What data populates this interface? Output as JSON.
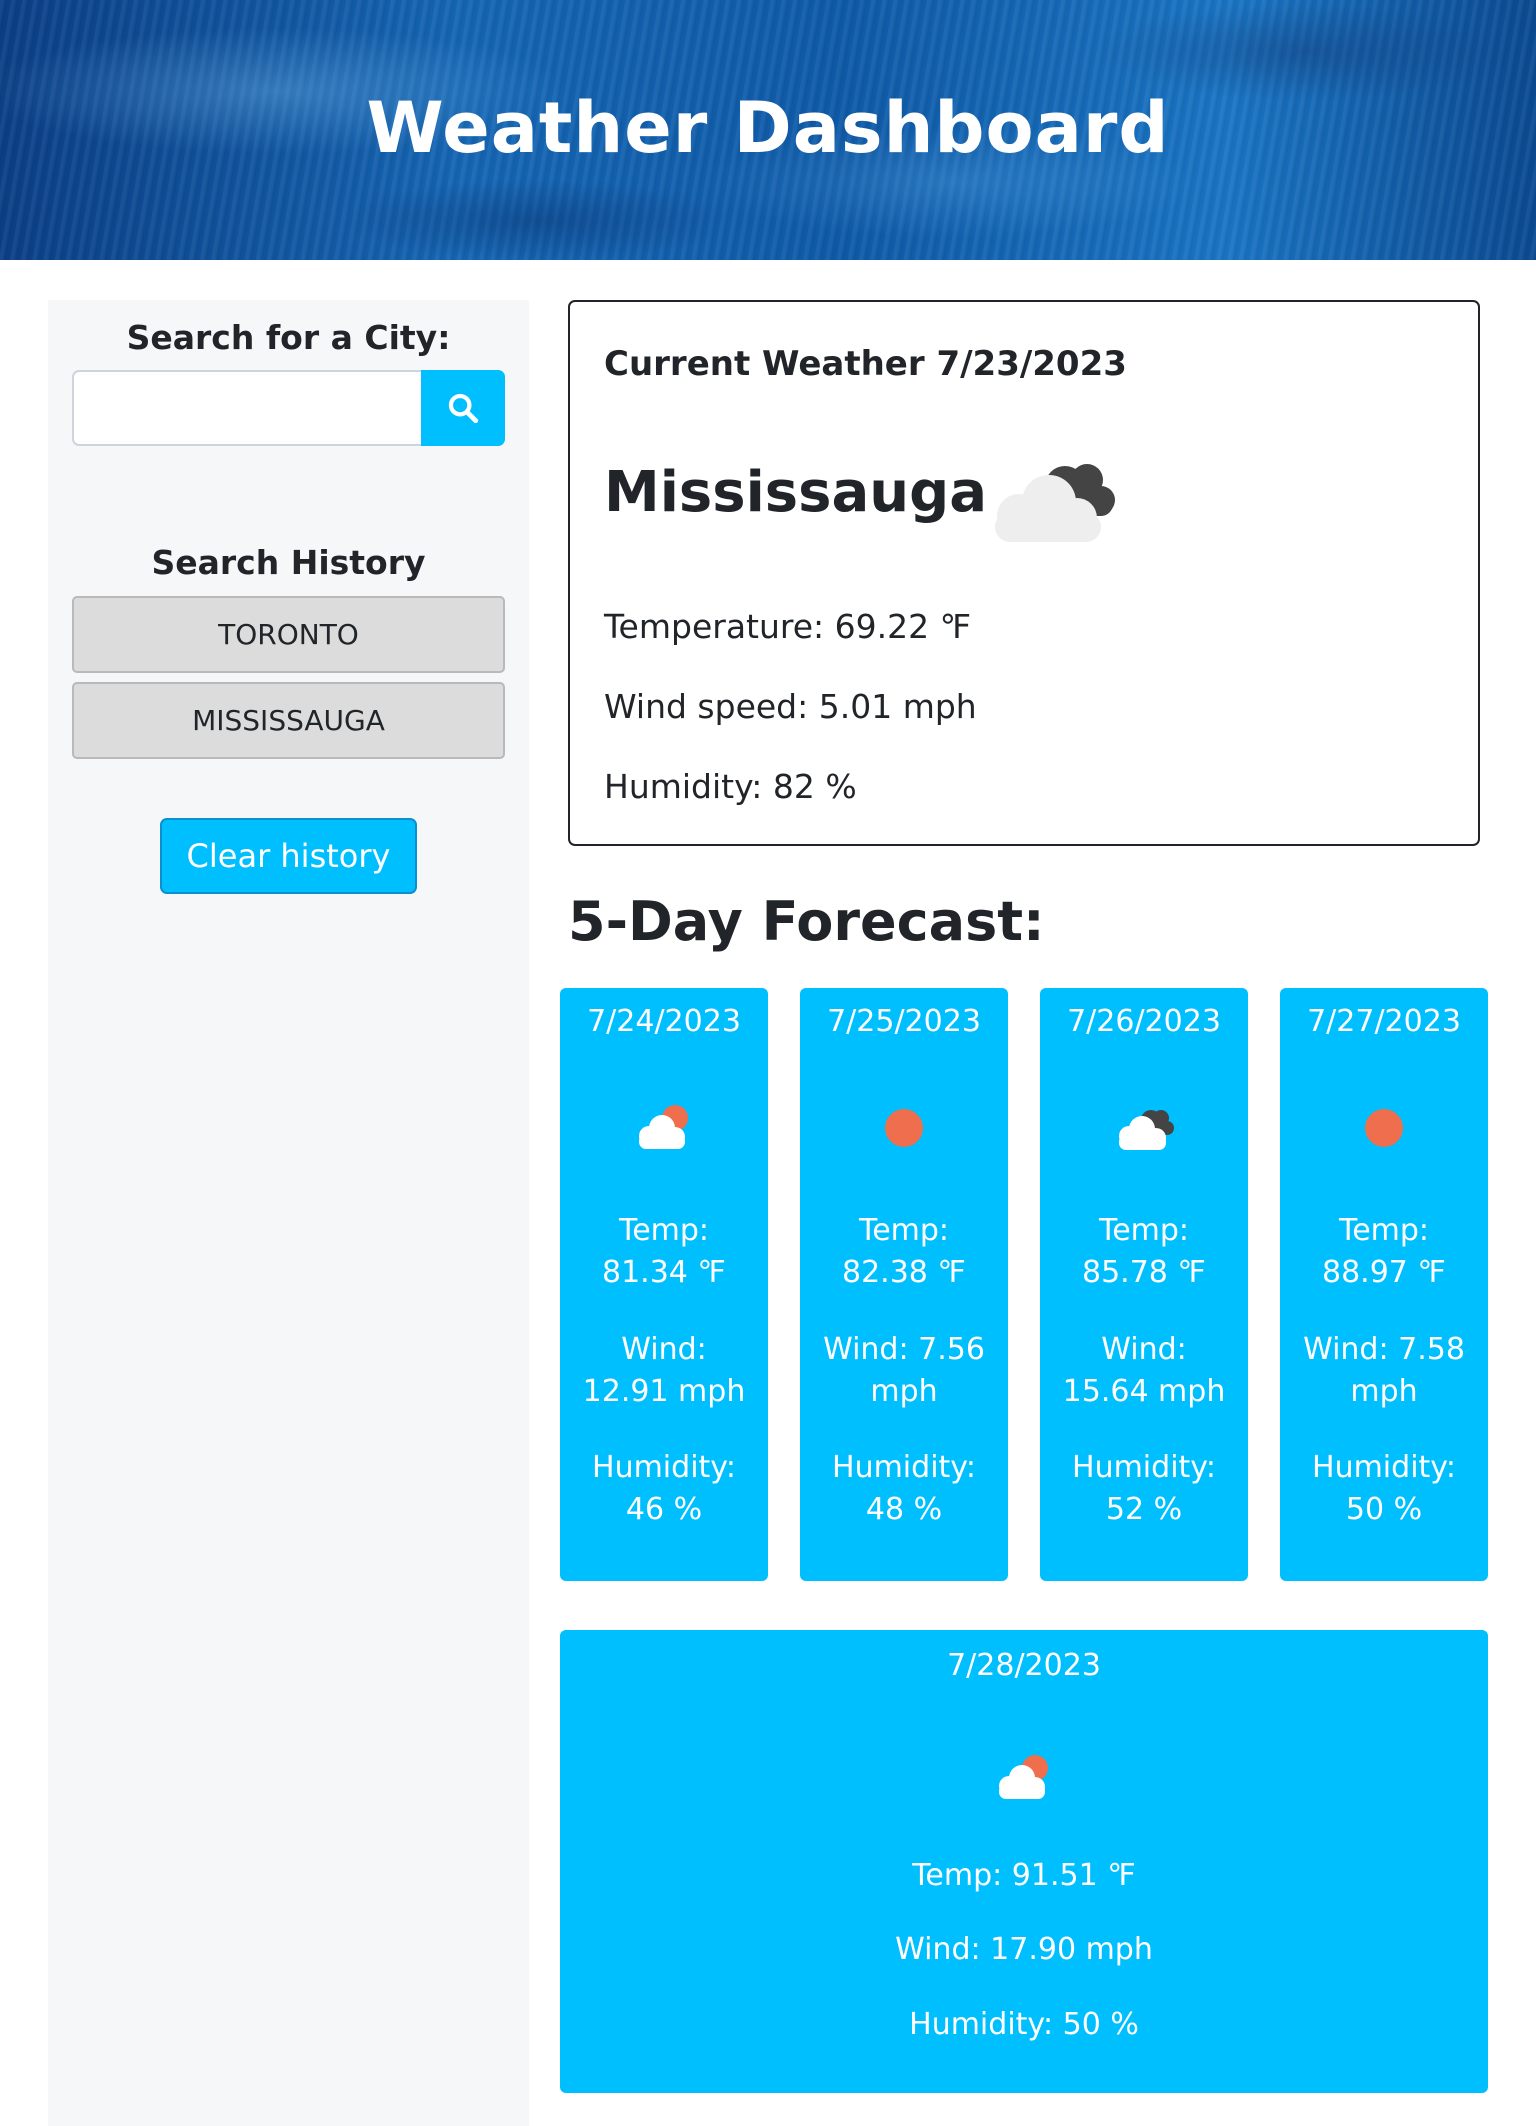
{
  "header": {
    "title": "Weather Dashboard"
  },
  "sidebar": {
    "search_label": "Search for a City:",
    "search_input_value": "",
    "search_input_placeholder": "",
    "search_button_icon": "search-icon",
    "history_label": "Search History",
    "history": [
      "TORONTO",
      "MISSISSAUGA"
    ],
    "clear_label": "Clear history"
  },
  "current": {
    "title": "Current Weather 7/23/2023",
    "city": "Mississauga",
    "icon": "broken-clouds-icon",
    "temperature": "Temperature: 69.22 ℉",
    "wind": "Wind speed: 5.01 mph",
    "humidity": "Humidity: 82 %"
  },
  "forecast": {
    "title": "5-Day Forecast:",
    "days": [
      {
        "date": "7/24/2023",
        "icon": "few-clouds-icon",
        "temp_label": "Temp:",
        "temp": "81.34 ℉",
        "wind_label": "Wind:",
        "wind": "12.91 mph",
        "hum_label": "Humidity:",
        "hum": "46 %"
      },
      {
        "date": "7/25/2023",
        "icon": "clear-sky-icon",
        "temp_label": "Temp:",
        "temp": "82.38 ℉",
        "wind_label": "Wind: 7.56",
        "wind": "mph",
        "hum_label": "Humidity:",
        "hum": "48 %"
      },
      {
        "date": "7/26/2023",
        "icon": "broken-clouds-icon",
        "temp_label": "Temp:",
        "temp": "85.78 ℉",
        "wind_label": "Wind:",
        "wind": "15.64 mph",
        "hum_label": "Humidity:",
        "hum": "52 %"
      },
      {
        "date": "7/27/2023",
        "icon": "clear-sky-icon",
        "temp_label": "Temp:",
        "temp": "88.97 ℉",
        "wind_label": "Wind: 7.58",
        "wind": "mph",
        "hum_label": "Humidity:",
        "hum": "50 %"
      }
    ],
    "last": {
      "date": "7/28/2023",
      "icon": "few-clouds-icon",
      "temp": "Temp: 91.51 ℉",
      "wind": "Wind: 17.90 mph",
      "hum": "Humidity: 50 %"
    }
  },
  "colors": {
    "accent": "#00bfff",
    "sun": "#ee6e4d",
    "dark_cloud": "#444444",
    "sidebar_bg": "#f6f7f9"
  }
}
